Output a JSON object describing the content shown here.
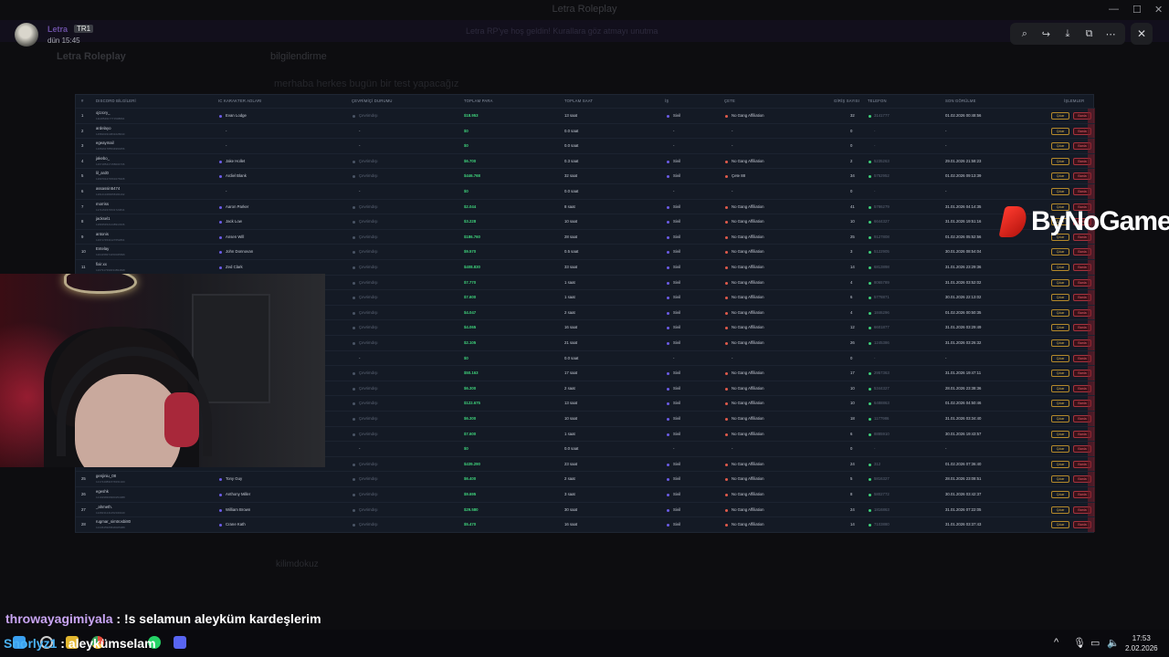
{
  "window": {
    "title": "Letra Roleplay",
    "controls": [
      "—",
      "☐",
      "✕"
    ]
  },
  "banner": {
    "text": "Letra RP'ye hoş geldin! Kurallara göz atmayı unutma"
  },
  "background": {
    "server_name": "Letra Roleplay",
    "channel": "bilgilendirme",
    "message": "merhaba herkes bugün bir test yapacağız",
    "user": "kilimdokuz"
  },
  "author": {
    "name": "Letra",
    "tag": "TR1",
    "time": "dün 15:45"
  },
  "toolbar": {
    "icons": [
      "zoom-in-icon",
      "forward-icon",
      "download-icon",
      "open-external-icon",
      "more-icon"
    ],
    "close": "✕"
  },
  "table": {
    "headers": [
      "#",
      "DISCORD BİLGİLERİ",
      "IC KARAKTER ADLARI",
      "ÇEVRİMİÇİ DURUMU",
      "TOPLAM PARA",
      "TOPLAM SAAT",
      "İŞ",
      "ÇETE",
      "GİRİŞ SAYISI",
      "TELEFON",
      "SON GÖRÜLME",
      "İŞLEMLER"
    ],
    "cikar_label": "Çıkar",
    "banla_label": "Banla",
    "offline_label": "Çevrimdışı",
    "rows": [
      {
        "n": "1",
        "discord": "oj1rory_",
        "id": "1114854917771508894",
        "char": "Evan Lodge",
        "money": "$18.953",
        "hours": "13 saat",
        "job": "Sivil",
        "gang": "No Gang Affiliation",
        "logins": "32",
        "phone": "3141777",
        "seen": "01.02.2026 00:48:56"
      },
      {
        "n": "2",
        "discord": "ardelayo",
        "id": "1158403310831028640",
        "char": "-",
        "money": "$0",
        "hours": "0.0 saat",
        "job": "-",
        "gang": "-",
        "logins": "0",
        "phone": "-",
        "seen": "-"
      },
      {
        "n": "3",
        "discord": "egeaymail",
        "id": "1165291785534960256",
        "char": "-",
        "money": "$0",
        "hours": "0.0 saat",
        "job": "-",
        "gang": "-",
        "logins": "0",
        "phone": "-",
        "seen": "-"
      },
      {
        "n": "4",
        "discord": "jakebo_",
        "id": "1167185417158004736",
        "char": "Jake Hollet",
        "money": "$6.700",
        "hours": "0.3 saat",
        "job": "Sivil",
        "gang": "No Gang Affiliation",
        "logins": "2",
        "phone": "5235263",
        "seen": "29.01.2026 21:58:23"
      },
      {
        "n": "5",
        "discord": "lil_ard0",
        "id": "1169701274563276908",
        "char": "Ardiel Blank",
        "money": "$446.768",
        "hours": "32 saat",
        "job": "Sivil",
        "gang": "Çete 88",
        "logins": "34",
        "phone": "5752952",
        "seen": "01.02.2026 09:13:39"
      },
      {
        "n": "6",
        "discord": "assassin5474",
        "id": "1181413483058184192",
        "char": "-",
        "money": "$0",
        "hours": "0.0 saat",
        "job": "-",
        "gang": "-",
        "logins": "0",
        "phone": "-",
        "seen": "-"
      },
      {
        "n": "7",
        "discord": "morriss",
        "id": "1174151574531720844",
        "char": "Aaron Parker",
        "money": "$2.044",
        "hours": "8 saat",
        "job": "Sivil",
        "gang": "No Gang Affiliation",
        "logins": "41",
        "phone": "5786279",
        "seen": "31.01.2026 04:14:35"
      },
      {
        "n": "8",
        "discord": "jacksel1",
        "id": "1189354521448910336",
        "char": "Jack Low",
        "money": "$3.228",
        "hours": "10 saat",
        "job": "Sivil",
        "gang": "No Gang Affiliation",
        "logins": "10",
        "phone": "6644327",
        "seen": "31.01.2026 19:51:16"
      },
      {
        "n": "9",
        "discord": "antonis",
        "id": "1197174534127652864",
        "char": "Ansen Will",
        "money": "$186.760",
        "hours": "28 saat",
        "job": "Sivil",
        "gang": "No Gang Affiliation",
        "logins": "25",
        "phone": "9127808",
        "seen": "01.02.2026 05:52:56"
      },
      {
        "n": "10",
        "discord": "Entelay",
        "id": "1204158374150045696",
        "char": "John Donnovan",
        "money": "$9.570",
        "hours": "0.5 saat",
        "job": "Sivil",
        "gang": "No Gang Affiliation",
        "logins": "3",
        "phone": "5122905",
        "seen": "30.01.2026 08:54:04"
      },
      {
        "n": "11",
        "discord": "fixir.xx",
        "id": "1207917390034894848",
        "char": "Zed Clark",
        "money": "$408.830",
        "hours": "33 saat",
        "job": "Sivil",
        "gang": "No Gang Affiliation",
        "logins": "14",
        "phone": "6813898",
        "seen": "31.01.2026 23:29:36"
      },
      {
        "n": "12",
        "discord": "",
        "id": "",
        "char": "",
        "money": "$7.770",
        "hours": "1 saat",
        "job": "Sivil",
        "gang": "No Gang Affiliation",
        "logins": "4",
        "phone": "8065789",
        "seen": "31.01.2026 03:52:02"
      },
      {
        "n": "13",
        "discord": "",
        "id": "",
        "char": "",
        "money": "$7.600",
        "hours": "1 saat",
        "job": "Sivil",
        "gang": "No Gang Affiliation",
        "logins": "6",
        "phone": "5778871",
        "seen": "30.01.2026 22:13:02"
      },
      {
        "n": "14",
        "discord": "",
        "id": "",
        "char": "",
        "money": "$4.047",
        "hours": "2 saat",
        "job": "Sivil",
        "gang": "No Gang Affiliation",
        "logins": "4",
        "phone": "1846296",
        "seen": "01.02.2026 00:50:35"
      },
      {
        "n": "15",
        "discord": "",
        "id": "",
        "char": "",
        "money": "$4.065",
        "hours": "16 saat",
        "job": "Sivil",
        "gang": "No Gang Affiliation",
        "logins": "12",
        "phone": "6601877",
        "seen": "31.01.2026 03:29:49"
      },
      {
        "n": "16",
        "discord": "",
        "id": "",
        "char": "",
        "money": "$2.105",
        "hours": "21 saat",
        "job": "Sivil",
        "gang": "No Gang Affiliation",
        "logins": "26",
        "phone": "1245386",
        "seen": "31.01.2026 03:26:32"
      },
      {
        "n": "17",
        "discord": "",
        "id": "",
        "char": "-",
        "money": "$0",
        "hours": "0.0 saat",
        "job": "-",
        "gang": "-",
        "logins": "0",
        "phone": "-",
        "seen": "-"
      },
      {
        "n": "18",
        "discord": "",
        "id": "",
        "char": "",
        "money": "$50.163",
        "hours": "17 saat",
        "job": "Sivil",
        "gang": "No Gang Affiliation",
        "logins": "17",
        "phone": "2957363",
        "seen": "31.01.2026 19:47:11"
      },
      {
        "n": "19",
        "discord": "",
        "id": "",
        "char": "",
        "money": "$6.300",
        "hours": "2 saat",
        "job": "Sivil",
        "gang": "No Gang Affiliation",
        "logins": "10",
        "phone": "5344327",
        "seen": "28.01.2026 23:38:36"
      },
      {
        "n": "20",
        "discord": "",
        "id": "",
        "char": "",
        "money": "$122.675",
        "hours": "13 saat",
        "job": "Sivil",
        "gang": "No Gang Affiliation",
        "logins": "10",
        "phone": "6488863",
        "seen": "01.02.2026 04:50:46"
      },
      {
        "n": "21",
        "discord": "",
        "id": "",
        "char": "",
        "money": "$6.300",
        "hours": "10 saat",
        "job": "Sivil",
        "gang": "No Gang Affiliation",
        "logins": "18",
        "phone": "1177986",
        "seen": "31.01.2026 03:34:40"
      },
      {
        "n": "22",
        "discord": "",
        "id": "",
        "char": "",
        "money": "$7.600",
        "hours": "1 saat",
        "job": "Sivil",
        "gang": "No Gang Affiliation",
        "logins": "6",
        "phone": "8885910",
        "seen": "30.01.2026 19:43:57"
      },
      {
        "n": "23",
        "discord": "",
        "id": "",
        "char": "-",
        "money": "$0",
        "hours": "0.0 saat",
        "job": "-",
        "gang": "-",
        "logins": "0",
        "phone": "-",
        "seen": "-"
      },
      {
        "n": "24",
        "discord": "",
        "id": "",
        "char": "",
        "money": "$439.290",
        "hours": "23 saat",
        "job": "Sivil",
        "gang": "No Gang Affiliation",
        "logins": "24",
        "phone": "312",
        "seen": "01.02.2026 07:36:40"
      },
      {
        "n": "25",
        "discord": "genjiniu_08",
        "id": "1217440891578151020",
        "char": "Tony Guy",
        "money": "$6.400",
        "hours": "2 saat",
        "job": "Sivil",
        "gang": "No Gang Affiliation",
        "logins": "5",
        "phone": "5816327",
        "seen": "28.01.2026 23:08:51"
      },
      {
        "n": "26",
        "discord": "egeshk",
        "id": "1219298309960254088",
        "char": "Anthony Miller",
        "money": "$9.695",
        "hours": "3 saat",
        "job": "Sivil",
        "gang": "No Gang Affiliation",
        "logins": "8",
        "phone": "5802772",
        "seen": "30.01.2026 03:42:37"
      },
      {
        "n": "27",
        "discord": "_ahmeth.",
        "id": "1228231241452349440",
        "char": "William Brown",
        "money": "$29.580",
        "hours": "30 saat",
        "job": "Sivil",
        "gang": "No Gang Affiliation",
        "logins": "24",
        "phone": "1816863",
        "seen": "31.01.2026 07:22:05"
      },
      {
        "n": "28",
        "discord": "rugmar_simtrosbi80",
        "id": "1244545905848025088",
        "char": "Crane Kath",
        "money": "$5.470",
        "hours": "16 saat",
        "job": "Sivil",
        "gang": "No Gang Affiliation",
        "logins": "14",
        "phone": "7103880",
        "seen": "31.01.2026 03:37:43"
      }
    ]
  },
  "watermark": {
    "text": "ByNoGame"
  },
  "chat": [
    {
      "user": "throwayagimiyala",
      "separator": " : ",
      "message": "!s selamun aleyküm kardeşlerim"
    },
    {
      "user": "Snorlyz1",
      "separator": " : ",
      "message": "aleykümselam"
    }
  ],
  "taskbar": {
    "time": "17:53",
    "date": "2.02.2026"
  },
  "colors": {
    "accent_green": "#3fd27b",
    "cikar": "#e1b64a",
    "banla": "#ef5f6c",
    "panel": "#141a25"
  }
}
